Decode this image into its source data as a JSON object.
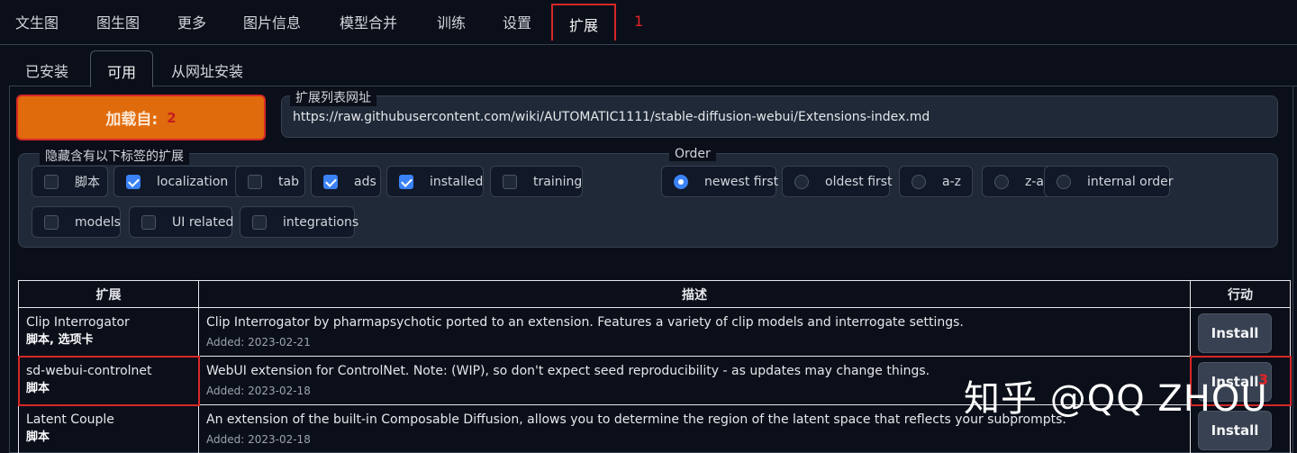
{
  "top_tabs": [
    "文生图",
    "图生图",
    "更多",
    "图片信息",
    "模型合并",
    "训练",
    "设置",
    "扩展"
  ],
  "active_top_tab": "扩展",
  "annotations": {
    "n1": "1",
    "n2": "2",
    "n3": "3"
  },
  "sub_tabs": [
    "已安装",
    "可用",
    "从网址安装"
  ],
  "load_button": "加载自:",
  "url_label": "扩展列表网址",
  "url_value": "https://raw.githubusercontent.com/wiki/AUTOMATIC1111/stable-diffusion-webui/Extensions-index.md",
  "hide_tags_label": "隐藏含有以下标签的扩展",
  "tags": [
    {
      "label": "脚本",
      "checked": false
    },
    {
      "label": "localization",
      "checked": true
    },
    {
      "label": "tab",
      "checked": false
    },
    {
      "label": "ads",
      "checked": true
    },
    {
      "label": "installed",
      "checked": true
    },
    {
      "label": "training",
      "checked": false
    },
    {
      "label": "models",
      "checked": false
    },
    {
      "label": "UI related",
      "checked": false
    },
    {
      "label": "integrations",
      "checked": false
    }
  ],
  "order_label": "Order",
  "order_options": [
    {
      "label": "newest first",
      "selected": true
    },
    {
      "label": "oldest first",
      "selected": false
    },
    {
      "label": "a-z",
      "selected": false
    },
    {
      "label": "z-a",
      "selected": false
    },
    {
      "label": "internal order",
      "selected": false
    }
  ],
  "table": {
    "headers": [
      "扩展",
      "描述",
      "行动"
    ],
    "rows": [
      {
        "name": "Clip Interrogator",
        "tags": "脚本, 选项卡",
        "description": "Clip Interrogator by pharmapsychotic ported to an extension. Features a variety of clip models and interrogate settings.",
        "added": "Added: 2023-02-21",
        "action": "Install"
      },
      {
        "name": "sd-webui-controlnet",
        "tags": "脚本",
        "description": "WebUI extension for ControlNet. Note: (WIP), so don't expect seed reproducibility - as updates may change things.",
        "added": "Added: 2023-02-18",
        "action": "Install"
      },
      {
        "name": "Latent Couple",
        "tags": "脚本",
        "description": "An extension of the built-in Composable Diffusion, allows you to determine the region of the latent space that reflects your subprompts.",
        "added": "Added: 2023-02-18",
        "action": "Install"
      }
    ]
  },
  "watermark": "知乎 @QQ ZHOU",
  "colors": {
    "accent_orange": "#e06b0c",
    "highlight_red": "#d62828",
    "checkbox_blue": "#3b82f6",
    "background": "#0b0f19"
  }
}
